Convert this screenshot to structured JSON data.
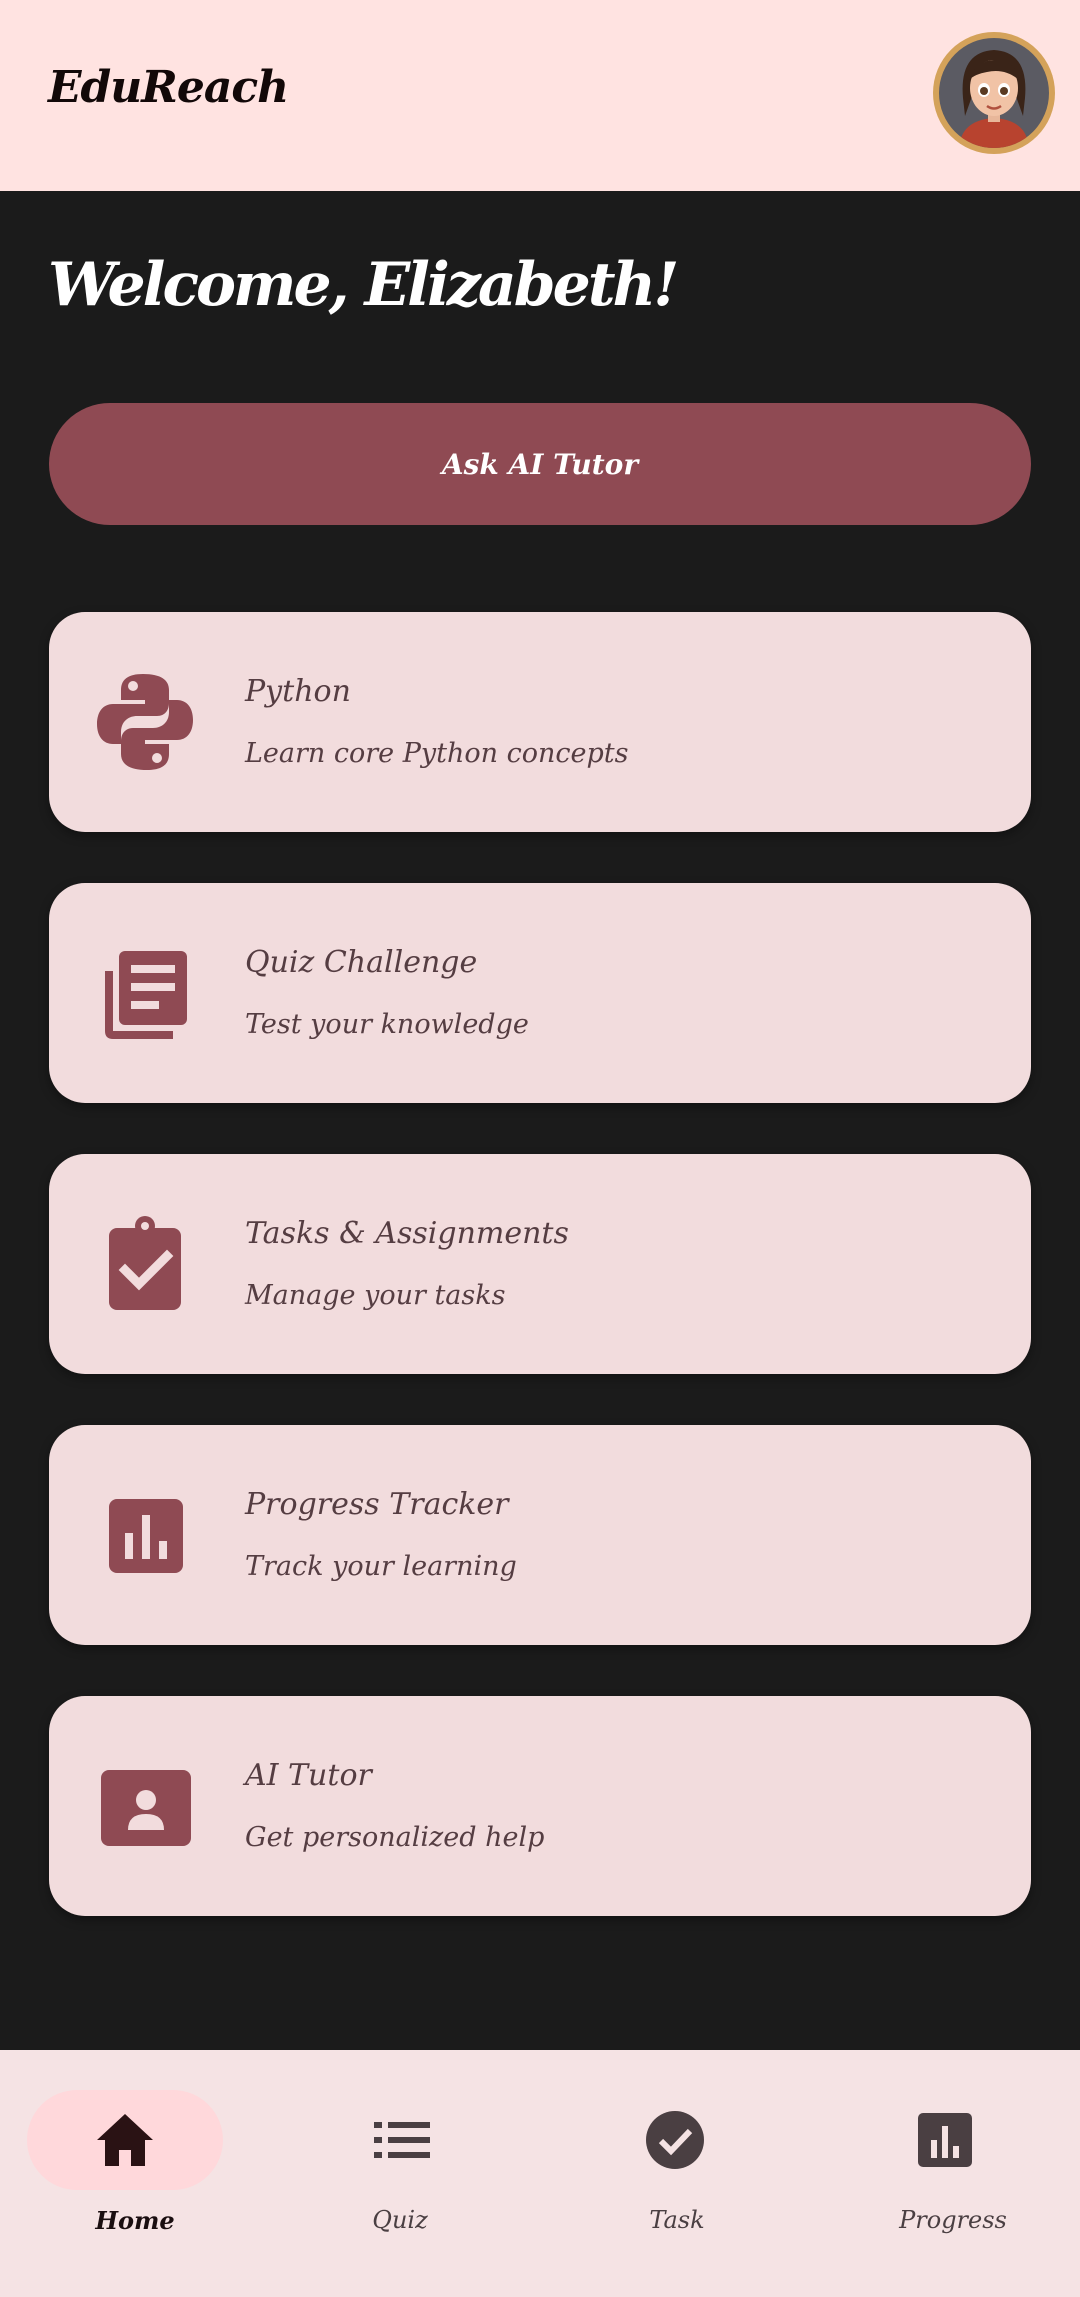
{
  "header": {
    "app_title": "EduReach"
  },
  "welcome": {
    "text": "Welcome, Elizabeth!"
  },
  "ask_button": {
    "label": "Ask AI Tutor"
  },
  "cards": [
    {
      "icon": "python-logo-icon",
      "title": "Python",
      "subtitle": "Learn core Python concepts"
    },
    {
      "icon": "library-books-icon",
      "title": "Quiz Challenge",
      "subtitle": "Test your knowledge"
    },
    {
      "icon": "clipboard-check-icon",
      "title": "Tasks & Assignments",
      "subtitle": "Manage your tasks"
    },
    {
      "icon": "bar-chart-icon",
      "title": "Progress Tracker",
      "subtitle": "Track your learning"
    },
    {
      "icon": "contact-card-icon",
      "title": "AI Tutor",
      "subtitle": "Get personalized help"
    }
  ],
  "bottom_nav": {
    "active": "Home",
    "items": [
      {
        "label": "Home",
        "icon": "home-icon"
      },
      {
        "label": "Quiz",
        "icon": "list-icon"
      },
      {
        "label": "Task",
        "icon": "check-circle-icon"
      },
      {
        "label": "Progress",
        "icon": "bar-chart-icon"
      }
    ]
  },
  "colors": {
    "header_bg": "#ffe3e1",
    "page_bg": "#1b1b1b",
    "accent": "#8f4a53",
    "card_bg": "#f2dcdd",
    "card_text": "#553d42",
    "nav_bg": "#f5e3e4",
    "nav_active_pill": "#ffd8db"
  }
}
